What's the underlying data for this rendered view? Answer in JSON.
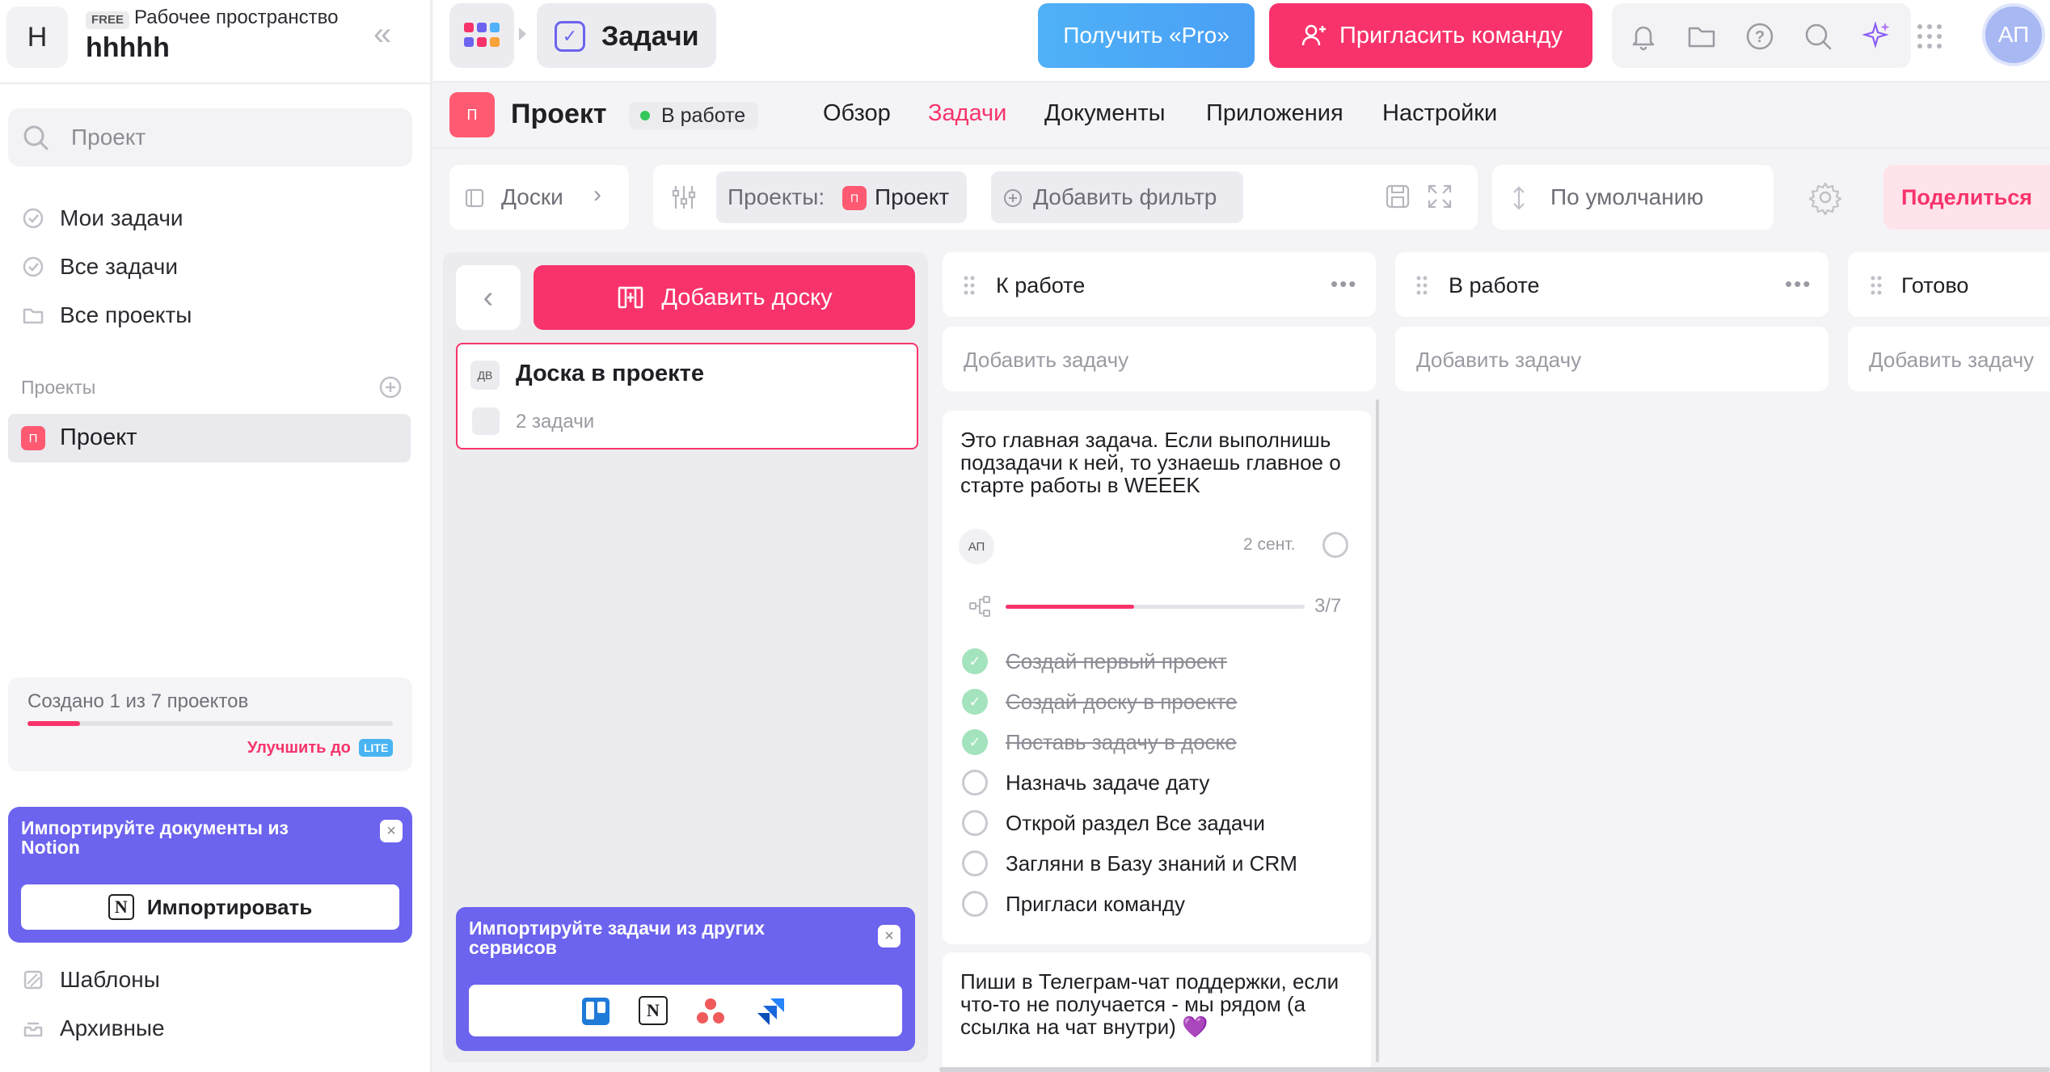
{
  "workspace": {
    "avatar_letter": "H",
    "plan": "FREE",
    "label": "Рабочее пространство",
    "name": "hhhhh"
  },
  "sidebar": {
    "search_placeholder": "Проект",
    "nav": [
      {
        "label": "Мои задачи",
        "icon": "check-circle-icon"
      },
      {
        "label": "Все задачи",
        "icon": "check-circle-icon"
      },
      {
        "label": "Все проекты",
        "icon": "folder-icon"
      }
    ],
    "projects_section": "Проекты",
    "projects": [
      {
        "badge": "П",
        "label": "Проект",
        "color": "#ff5a72"
      }
    ],
    "quota": {
      "text": "Создано 1 из 7 проектов",
      "used": 1,
      "total": 7,
      "upgrade": "Улучшить до",
      "upgrade_badge": "LITE"
    },
    "notion_card": {
      "title": "Импортируйте документы из Notion",
      "button": "Импортировать"
    },
    "footer": [
      {
        "label": "Шаблоны",
        "icon": "templates-icon"
      },
      {
        "label": "Архивные",
        "icon": "archive-icon"
      }
    ]
  },
  "topbar": {
    "breadcrumb": "Задачи",
    "pro_button": "Получить «Pro»",
    "invite_button": "Пригласить команду",
    "tools": [
      "bell-icon",
      "folder-icon",
      "help-icon",
      "search-icon",
      "sparkles-icon",
      "apps-grid-icon"
    ],
    "user_initials": "АП"
  },
  "project": {
    "badge": "П",
    "title": "Проект",
    "status": "В работе",
    "tabs": [
      "Обзор",
      "Задачи",
      "Документы",
      "Приложения",
      "Настройки"
    ],
    "active_tab": "Задачи"
  },
  "toolbar": {
    "boards_label": "Доски",
    "filter_prefix": "Проекты:",
    "filter_value": "Проект",
    "add_filter": "Добавить фильтр",
    "sort": "По умолчанию",
    "share": "Поделиться"
  },
  "boards_panel": {
    "add_board": "Добавить доску",
    "boards": [
      {
        "badge": "ДВ",
        "name": "Доска в проекте",
        "count": "2 задачи"
      }
    ],
    "import_card": {
      "title": "Импортируйте задачи из других сервисов",
      "services": [
        "trello-icon",
        "notion-icon",
        "asana-icon",
        "jira-icon"
      ]
    }
  },
  "columns": [
    {
      "title": "К работе",
      "add_task": "Добавить задачу"
    },
    {
      "title": "В работе",
      "add_task": "Добавить задачу"
    },
    {
      "title": "Готово",
      "add_task": "Добавить задачу"
    }
  ],
  "tasks": [
    {
      "title": "Это главная задача. Если выполнишь подзадачи к ней, то узнаешь главное о старте работы в WEEEK",
      "assignee": "АП",
      "date": "2 сент.",
      "progress_text": "3/7",
      "progress_done": 3,
      "progress_total": 7,
      "subtasks": [
        {
          "label": "Создай первый проект",
          "done": true
        },
        {
          "label": "Создай доску в проекте",
          "done": true
        },
        {
          "label": "Поставь задачу в доске",
          "done": true
        },
        {
          "label": "Назначь задаче дату",
          "done": false
        },
        {
          "label": "Открой раздел Все задачи",
          "done": false
        },
        {
          "label": "Загляни в Базу знаний и CRM",
          "done": false
        },
        {
          "label": "Пригласи команду",
          "done": false
        }
      ]
    },
    {
      "title": "Пиши в Телеграм-чат поддержки, если что-то не получается - мы рядом (а ссылка на чат внутри) 💜"
    }
  ],
  "colors": {
    "accent": "#f8336b",
    "purple": "#6c63ee",
    "pro_blue": "#4fb1f7",
    "done_green": "#a3e3bd"
  }
}
